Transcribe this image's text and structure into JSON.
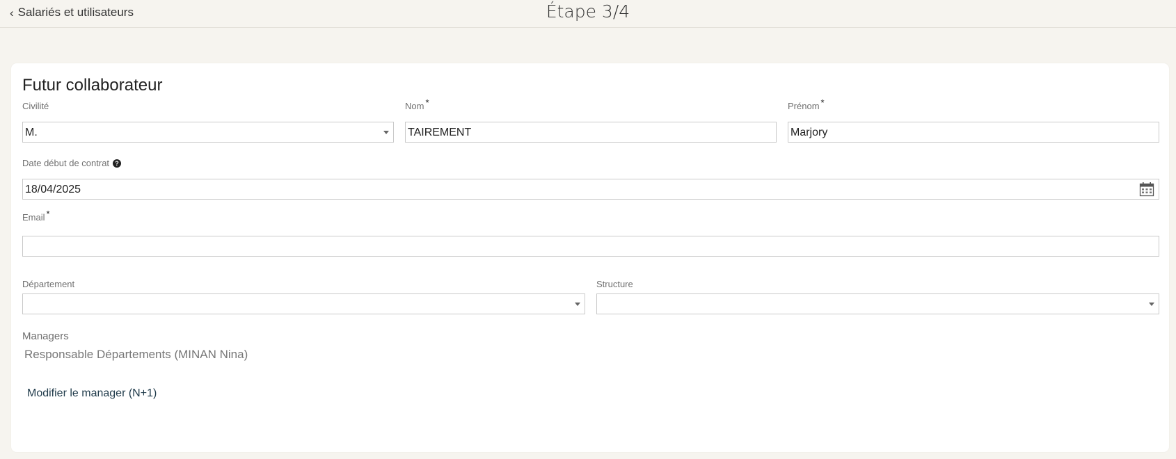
{
  "header": {
    "back_label": "Salariés et utilisateurs",
    "step_title": "Étape 3/4"
  },
  "form": {
    "title": "Futur collaborateur",
    "civilite": {
      "label": "Civilité",
      "value": "M."
    },
    "nom": {
      "label": "Nom",
      "required_mark": "*",
      "value": "TAIREMENT"
    },
    "prenom": {
      "label": "Prénom",
      "required_mark": "*",
      "value": "Marjory"
    },
    "date_debut": {
      "label": "Date début de contrat",
      "help": "?",
      "value": "18/04/2025"
    },
    "email": {
      "label": "Email",
      "required_mark": "*",
      "value": ""
    },
    "departement": {
      "label": "Département",
      "value": ""
    },
    "structure": {
      "label": "Structure",
      "value": ""
    },
    "managers": {
      "label": "Managers",
      "value": "Responsable Départements (MINAN Nina)",
      "modify_label": "Modifier le manager (N+1)"
    }
  },
  "icons": {
    "back": "chevron-left-icon",
    "dropdown": "caret-down-icon",
    "help": "question-circle-icon",
    "calendar": "calendar-icon"
  }
}
